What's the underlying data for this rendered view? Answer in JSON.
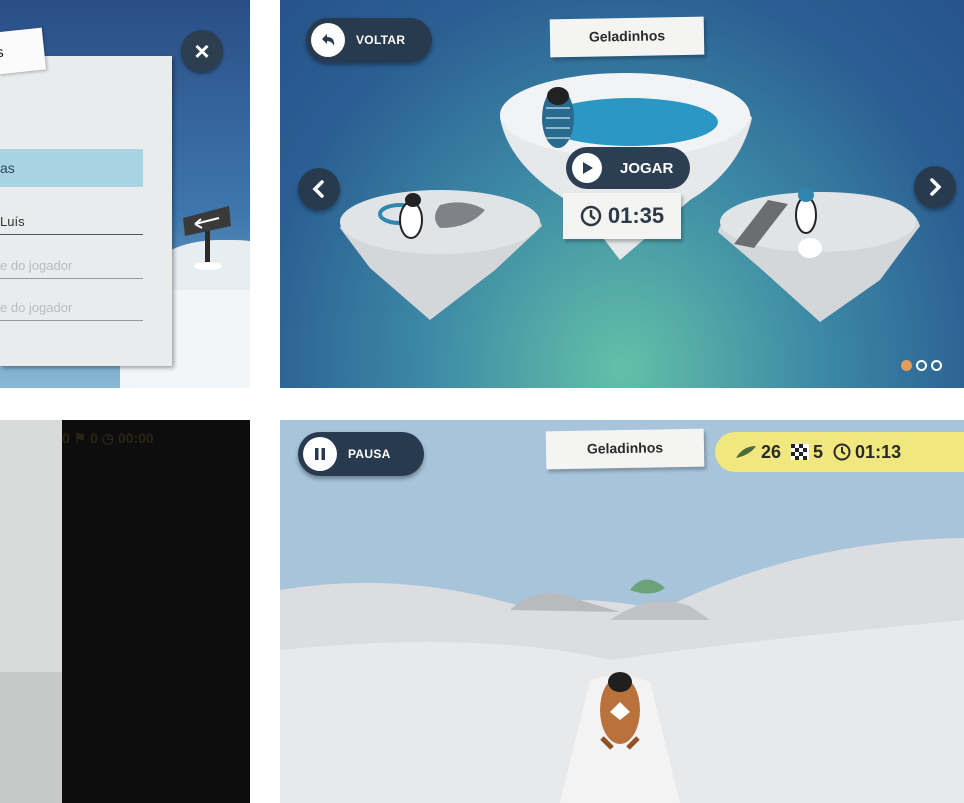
{
  "menu_panel": {
    "tab_label": "s",
    "selected_item": "as",
    "field_name": "Luís",
    "field_placeholder_1": "e do jogador",
    "field_placeholder_2": "e do jogador",
    "close_icon": "close-icon"
  },
  "level_select": {
    "back_label": "VOLTAR",
    "level_title": "Geladinhos",
    "play_label": "JOGAR",
    "best_time": "01:35",
    "page_indicator": {
      "count": 3,
      "active": 0
    }
  },
  "loading_panel": {
    "hud_text": "0  ⚑ 0  ◷ 00:00"
  },
  "gameplay": {
    "pause_label": "PAUSA",
    "level_title": "Geladinhos",
    "fish_count": "26",
    "flags_count": "5",
    "time": "01:13"
  },
  "colors": {
    "button_dark": "#283b4e",
    "hud_yellow": "#f0e77f",
    "menu_highlight": "#a8d3e3"
  }
}
